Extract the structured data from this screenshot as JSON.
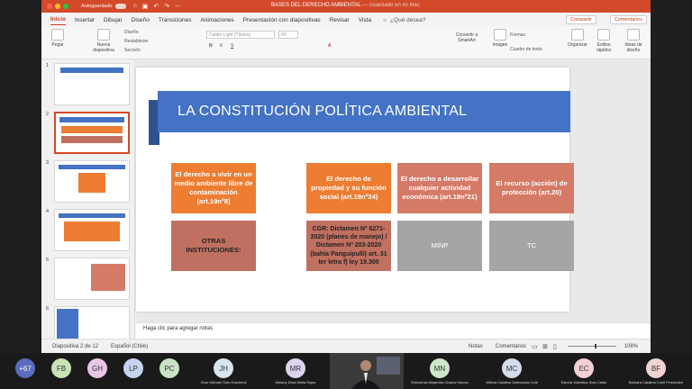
{
  "window": {
    "autosave_label": "Autoguardado",
    "doc_title": "BASES DEL DERECHO AMBIENTAL",
    "doc_subtitle": "— Guardado en mi Mac"
  },
  "tabs": [
    "Inicio",
    "Insertar",
    "Dibujar",
    "Diseño",
    "Transiciones",
    "Animaciones",
    "Presentación con diapositivas",
    "Revisar",
    "Vista"
  ],
  "search_label": "¿Qué desea?",
  "share_label": "Compartir",
  "comments_label": "Comentarios",
  "ribbon": {
    "paste": "Pegar",
    "new_slide": "Nueva diapositiva",
    "layout": "Diseño",
    "reset": "Restablecer",
    "section": "Sección",
    "font_name": "Calibri Light (Títulos)",
    "font_size": "40",
    "convert_smartart": "Convertir a SmartArt",
    "image": "Imagen",
    "shapes": "Formas",
    "text_box": "Cuadro de texto",
    "arrange": "Organizar",
    "quick_styles": "Estilos rápidos",
    "design_ideas": "Ideas de diseño"
  },
  "thumbnails": [
    "1",
    "2",
    "3",
    "4",
    "5",
    "6"
  ],
  "slide": {
    "title": "LA CONSTITUCIÓN POLÍTICA AMBIENTAL",
    "row1": [
      "El derecho a vivir en un medio ambiente libre de contaminación (art.19nº8)",
      "El derecho de propiedad y su función social (art.19nº24)",
      "El derecho a desarrollar cualquier actividad económica (art.19nº21)",
      "El recurso (acción) de protección (art.20)"
    ],
    "row2": [
      "OTRAS INSTITUCIONES:",
      "CGR: Dictamen Nº 6271-2020 (planes de manejo) / Dictamen Nº 203-2020 (bahía Panguipulli) art. 31 ter letra f) ley 19.300",
      "MINP",
      "TC"
    ]
  },
  "notes_placeholder": "Haga clic para agregar notas",
  "status": {
    "slide_count": "Diapositiva 2 de 12",
    "language": "Español (Chile)",
    "notes": "Notas",
    "comments": "Comentarios",
    "zoom": "108%"
  },
  "participants": [
    {
      "initials": "+67",
      "name": "",
      "color": "#5b6bbf"
    },
    {
      "initials": "FB",
      "name": "",
      "color": "#c7e3b5"
    },
    {
      "initials": "GH",
      "name": "",
      "color": "#e8c7e6"
    },
    {
      "initials": "LP",
      "name": "",
      "color": "#c6d4f0"
    },
    {
      "initials": "PC",
      "name": "",
      "color": "#c9e4c5"
    },
    {
      "initials": "JH",
      "name": "Jhon Michael Soto Huenteuil",
      "color": "#d6e6ee"
    },
    {
      "initials": "MR",
      "name": "Melany Elisa Melia Rojas",
      "color": "#ddd3ef"
    },
    {
      "initials": "MN",
      "name": "Monserrat Alejandra Chávez Novoa",
      "color": "#cfe6c9"
    },
    {
      "initials": "MC",
      "name": "Milena Catalina Valenzuela Colil",
      "color": "#d3dcea"
    },
    {
      "initials": "EC",
      "name": "Estrela Valentina Soto Caldo",
      "color": "#f3d0d0"
    },
    {
      "initials": "BF",
      "name": "Bárbara Catalina Cohil Fernández",
      "color": "#f1d3d6"
    }
  ]
}
